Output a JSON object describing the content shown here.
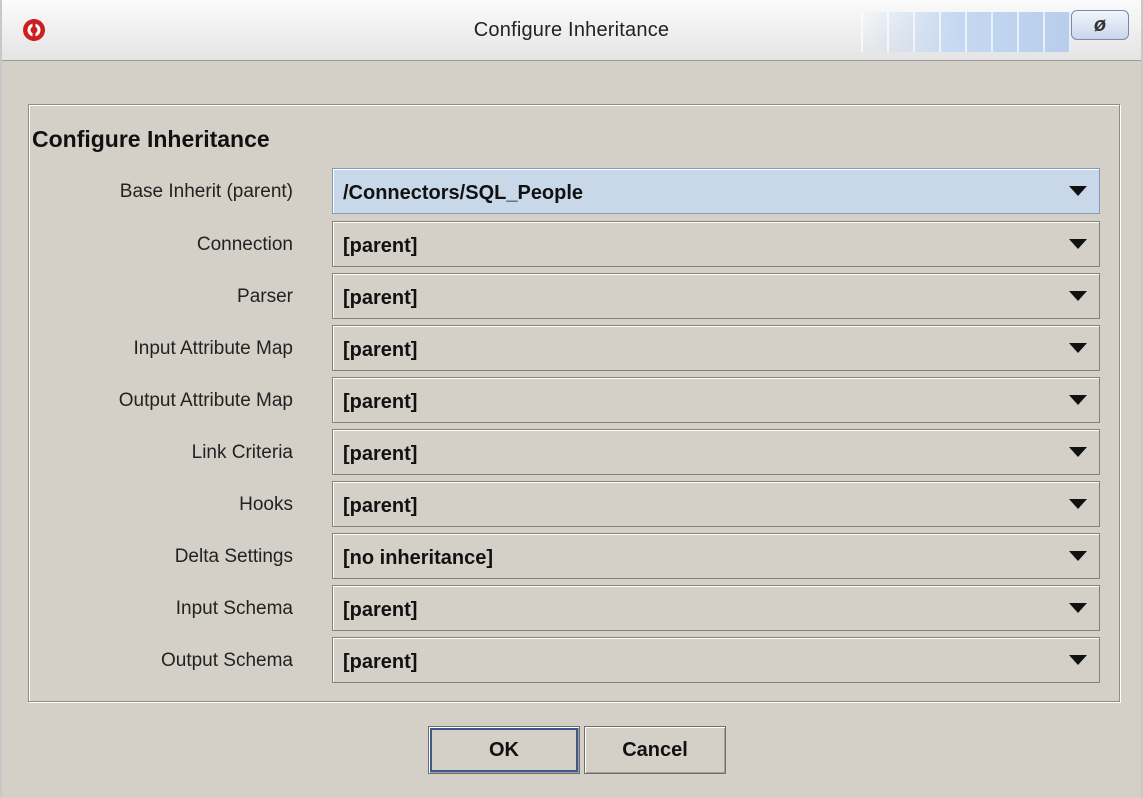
{
  "window": {
    "title": "Configure Inheritance",
    "accent_color": "#c5d9f2",
    "close_symbol": "ø"
  },
  "section": {
    "title": "Configure Inheritance"
  },
  "fields": [
    {
      "label": "Base Inherit (parent)",
      "value": "/Connectors/SQL_People"
    },
    {
      "label": "Connection",
      "value": "[parent]"
    },
    {
      "label": "Parser",
      "value": "[parent]"
    },
    {
      "label": "Input Attribute Map",
      "value": "[parent]"
    },
    {
      "label": "Output Attribute Map",
      "value": "[parent]"
    },
    {
      "label": "Link Criteria",
      "value": "[parent]"
    },
    {
      "label": "Hooks",
      "value": "[parent]"
    },
    {
      "label": "Delta Settings",
      "value": "[no inheritance]"
    },
    {
      "label": "Input Schema",
      "value": "[parent]"
    },
    {
      "label": "Output Schema",
      "value": "[parent]"
    }
  ],
  "buttons": {
    "ok": "OK",
    "cancel": "Cancel"
  }
}
